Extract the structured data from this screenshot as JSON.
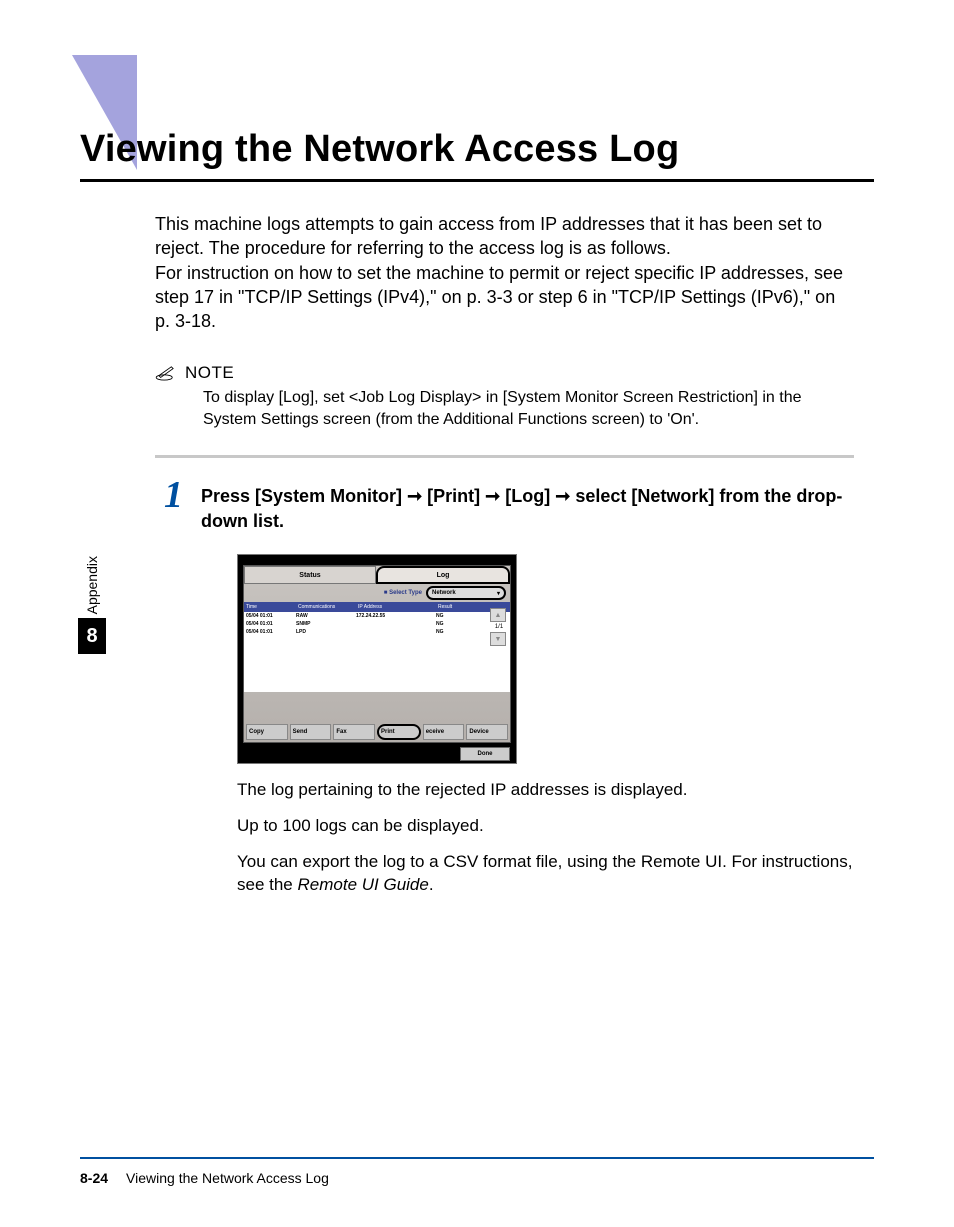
{
  "title": "Viewing the Network Access Log",
  "intro_para": "This machine logs attempts to gain access from IP addresses that it has been set to reject. The procedure for referring to the access log is as follows.\nFor instruction on how to set the machine to permit or reject specific IP addresses, see step 17 in \"TCP/IP Settings (IPv4),\" on p. 3-3 or step 6 in \"TCP/IP Settings (IPv6),\" on p. 3-18.",
  "note_label": "NOTE",
  "note_body": "To display [Log], set <Job Log Display> in [System Monitor Screen Restriction] in the System Settings screen (from the Additional Functions screen) to 'On'.",
  "step_num": "1",
  "step_text_parts": {
    "a": "Press [System Monitor] ",
    "b": " [Print] ",
    "c": " [Log] ",
    "d": " select [Network] from the drop-down list."
  },
  "arrow": "➞",
  "screenshot": {
    "tab_status": "Status",
    "tab_log": "Log",
    "select_label": "■ Select Type",
    "select_value": "Network",
    "headers": {
      "time": "Time",
      "comm": "Communications",
      "ip": "IP Address",
      "result": "Result"
    },
    "rows": [
      {
        "time": "05/04 01:01",
        "comm": "RAW",
        "ip": "172.24.22.55",
        "result": "NG"
      },
      {
        "time": "05/04 01:01",
        "comm": "SNMP",
        "ip": "",
        "result": "NG"
      },
      {
        "time": "05/04 01:01",
        "comm": "LPD",
        "ip": "",
        "result": "NG"
      }
    ],
    "page_indicator": "1/1",
    "bottom_tabs": [
      "Copy",
      "Send",
      "Fax",
      "Print",
      "eceive",
      "Device"
    ],
    "done": "Done"
  },
  "after": {
    "p1": "The log pertaining to the rejected IP addresses is displayed.",
    "p2": "Up to 100 logs can be displayed.",
    "p3a": "You can export the log to a CSV format file, using the Remote UI. For instructions, see the ",
    "p3b": "Remote UI Guide",
    "p3c": "."
  },
  "side": {
    "label": "Appendix",
    "num": "8"
  },
  "footer": {
    "page": "8-24",
    "title": "Viewing the Network Access Log"
  }
}
